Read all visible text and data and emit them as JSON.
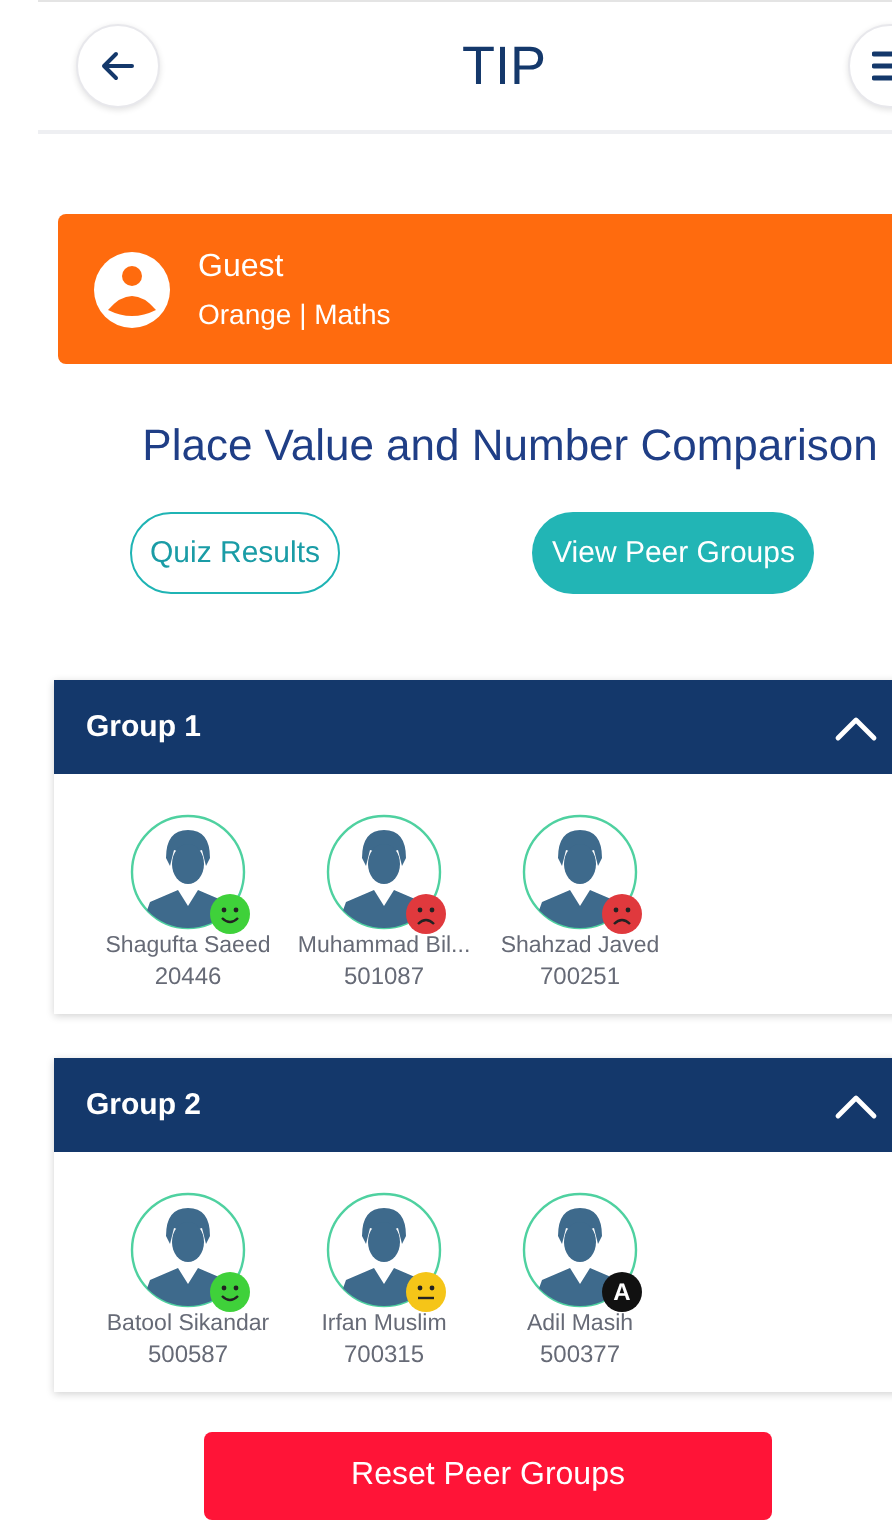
{
  "header": {
    "title": "TIP"
  },
  "user": {
    "name": "Guest",
    "subtitle": "Orange | Maths"
  },
  "topic": "Place Value and Number Comparison",
  "actions": [
    {
      "label": "Quiz Results",
      "kind": "outline"
    },
    {
      "label": "View Peer Groups",
      "kind": "filled"
    }
  ],
  "groups": [
    {
      "title": "Group 1",
      "expanded": true,
      "members": [
        {
          "name": "Shagufta Saeed",
          "id": "20446",
          "kind": "happy"
        },
        {
          "name": "Muhammad Bil...",
          "id": "501087",
          "kind": "sad"
        },
        {
          "name": "Shahzad Javed",
          "id": "700251",
          "kind": "sad"
        }
      ]
    },
    {
      "title": "Group 2",
      "expanded": true,
      "members": [
        {
          "name": "Batool Sikandar",
          "id": "500587",
          "kind": "happy"
        },
        {
          "name": "Irfan Muslim",
          "id": "700315",
          "kind": "neutral"
        },
        {
          "name": "Adil Masih",
          "id": "500377",
          "kind": "absent",
          "badge_text": "A"
        }
      ]
    }
  ],
  "reset_button": "Reset Peer Groups"
}
